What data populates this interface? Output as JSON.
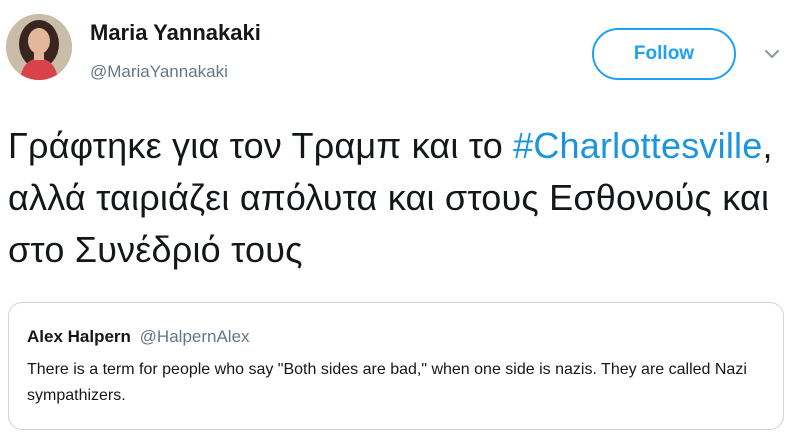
{
  "author": {
    "name": "Maria Yannakaki",
    "handle": "@MariaYannakaki"
  },
  "follow_button": {
    "label": "Follow"
  },
  "tweet": {
    "text_before": "Γράφτηκε για τον Τραμπ και το ",
    "hashtag": "#Charlottesville",
    "text_after": ", αλλά ταιριάζει απόλυτα και στους Εσθονούς και στο Συνέδριό τους"
  },
  "quoted_tweet": {
    "author_name": "Alex Halpern",
    "author_handle": "@HalpernAlex",
    "text": "There is a term for people who say \"Both sides are bad,\" when one side is nazis. They are called Nazi sympathizers."
  },
  "colors": {
    "accent": "#1da1f2",
    "hashtag": "#1b95e0",
    "secondary_text": "#657786",
    "border": "#ccd6dd"
  },
  "icons": {
    "menu": "chevron-down-icon"
  }
}
